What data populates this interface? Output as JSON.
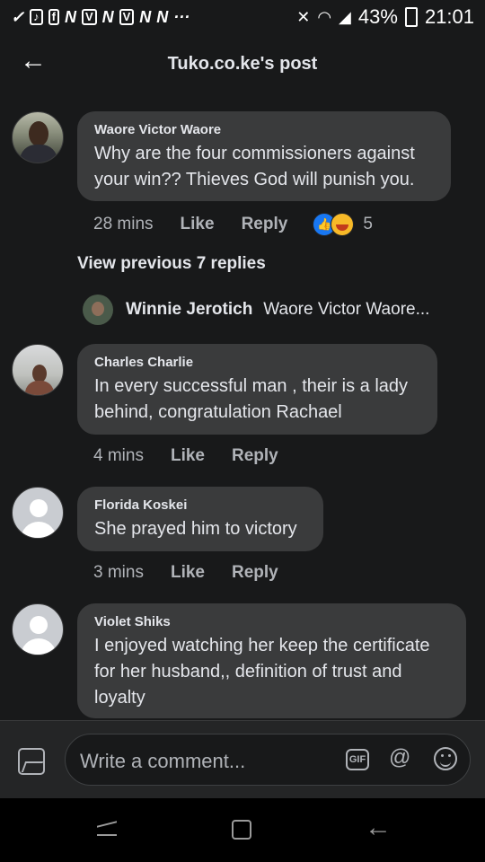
{
  "status_bar": {
    "left_icons": [
      "check-icon",
      "tiktok-icon",
      "facebook-icon",
      "n-icon",
      "v-icon",
      "n-icon",
      "v-icon",
      "n-icon",
      "n-icon",
      "more-icon"
    ],
    "battery_percent": "43%",
    "time": "21:01"
  },
  "header": {
    "title": "Tuko.co.ke's post"
  },
  "comments": [
    {
      "author": "Waore Victor Waore",
      "text": "Why are the four commissioners against your win?? Thieves God will punish you.",
      "time": "28 mins",
      "like_label": "Like",
      "reply_label": "Reply",
      "reaction_count": "5",
      "reactions": [
        "like",
        "haha"
      ]
    },
    {
      "author": "Charles Charlie",
      "text": "In every successful man , their is a lady behind, congratulation Rachael",
      "time": "4 mins",
      "like_label": "Like",
      "reply_label": "Reply"
    },
    {
      "author": "Florida Koskei",
      "text": "She prayed him to victory",
      "time": "3 mins",
      "like_label": "Like",
      "reply_label": "Reply"
    },
    {
      "author": "Violet Shiks",
      "text": "I enjoyed watching her keep the certificate for her husband,, definition of trust and loyalty"
    }
  ],
  "view_previous": "View previous 7 replies",
  "reply_preview": {
    "author": "Winnie Jerotich",
    "text": "Waore Victor Waore..."
  },
  "composer": {
    "placeholder": "Write a comment...",
    "gif_label": "GIF",
    "at_label": "@"
  },
  "colors": {
    "background": "#18191a",
    "bubble": "#3a3b3c",
    "like_blue": "#1877f2",
    "haha_yellow": "#f7b928"
  }
}
